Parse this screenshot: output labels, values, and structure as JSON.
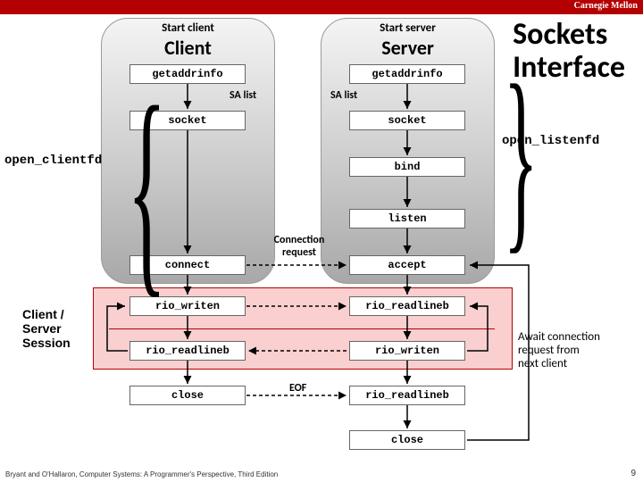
{
  "brand": "Carnegie Mellon",
  "title_l1": "Sockets",
  "title_l2": "Interface",
  "client_header_small": "Start client",
  "client_header_big": "Client",
  "server_header_small": "Start server",
  "server_header_big": "Server",
  "sa_list": "SA list",
  "open_clientfd": "open_clientfd",
  "open_listenfd": "open_listenfd",
  "session_label_l1": "Client /",
  "session_label_l2": "Server",
  "session_label_l3": "Session",
  "conn_req_l1": "Connection",
  "conn_req_l2": "request",
  "eof": "EOF",
  "await_l1": "Await connection",
  "await_l2": "request from",
  "await_l3": "next client",
  "boxes": {
    "c_getaddr": "getaddrinfo",
    "c_socket": "socket",
    "c_connect": "connect",
    "c_writen": "rio_writen",
    "c_readlineb": "rio_readlineb",
    "c_close": "close",
    "s_getaddr": "getaddrinfo",
    "s_socket": "socket",
    "s_bind": "bind",
    "s_listen": "listen",
    "s_accept": "accept",
    "s_readlineb": "rio_readlineb",
    "s_writen": "rio_writen",
    "s_readlineb2": "rio_readlineb",
    "s_close": "close"
  },
  "footer": "Bryant and O'Hallaron, Computer Systems: A Programmer's Perspective, Third Edition",
  "page": "9"
}
